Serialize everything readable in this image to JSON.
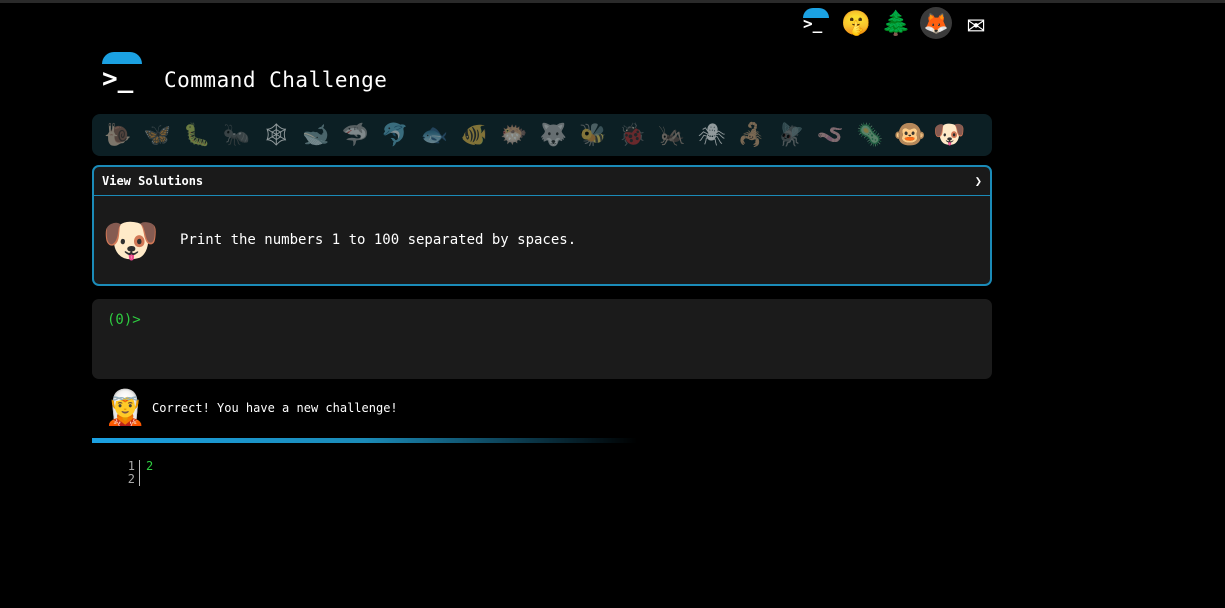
{
  "header": {
    "title": "Command Challenge",
    "logo_prompt": ">_"
  },
  "top_nav": [
    {
      "name": "terminal-icon",
      "glyph": ">_"
    },
    {
      "name": "shushing-face-icon",
      "glyph": "🤫"
    },
    {
      "name": "tree-icon",
      "glyph": "🌲"
    },
    {
      "name": "gitlab-icon",
      "glyph": "🦊"
    },
    {
      "name": "envelope-icon",
      "glyph": "✉"
    }
  ],
  "animals": [
    "🐌",
    "🦋",
    "🐛",
    "🐜",
    "🕸",
    "🐋",
    "🦈",
    "🐬",
    "🐟",
    "🐠",
    "🐡",
    "🐺",
    "🐝",
    "🐞",
    "🦗",
    "🕷",
    "🦂",
    "🪰",
    "🪱",
    "🦠",
    "🐵",
    "🐶"
  ],
  "challenge": {
    "header_label": "View Solutions",
    "chevron": "❯",
    "avatar": "🐶",
    "text": "Print the numbers 1 to 100 separated by spaces."
  },
  "terminal": {
    "prompt": "(0)>",
    "input_value": ""
  },
  "feedback": {
    "avatar": "🧝",
    "text": "Correct! You have a new challenge!"
  },
  "progress": {
    "fraction": 0.6
  },
  "output": {
    "lines": [
      {
        "num": "1",
        "text": "2"
      },
      {
        "num": "2",
        "text": ""
      }
    ]
  },
  "colors": {
    "accent": "#1ba1e2",
    "prompt": "#2ecc40",
    "panel": "#1a1a1a"
  }
}
